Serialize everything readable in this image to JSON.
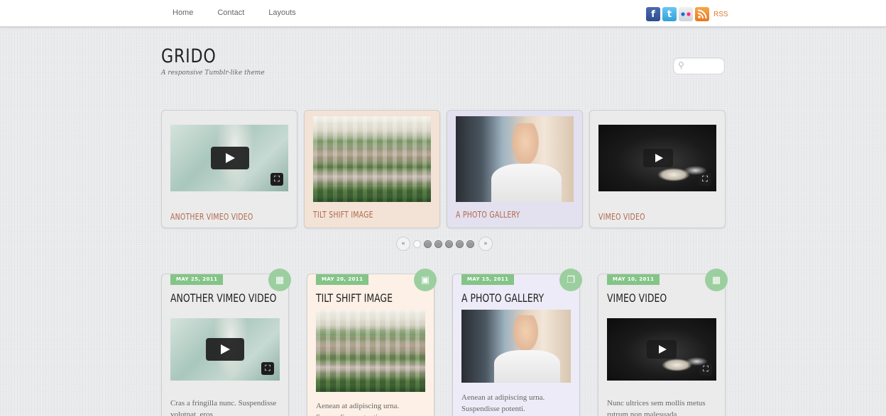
{
  "nav": {
    "items": [
      {
        "label": "Home"
      },
      {
        "label": "Contact"
      },
      {
        "label": "Layouts"
      }
    ]
  },
  "social": {
    "facebook_glyph": "f",
    "twitter_glyph": "t",
    "flickr_glyph": "••",
    "rss_glyph": "◉",
    "rss_label": "RSS"
  },
  "header": {
    "logo": "GRIDO",
    "tagline": "A responsive Tumblr-like theme"
  },
  "search": {
    "icon_glyph": "⚲",
    "placeholder": "",
    "value": ""
  },
  "slider": {
    "prev_label": "«",
    "next_label": "»",
    "slide_count": 6,
    "active_index": 0,
    "items": [
      {
        "title": "ANOTHER VIMEO VIDEO",
        "type": "video",
        "bg": "#ebebeb"
      },
      {
        "title": "TILT SHIFT IMAGE",
        "type": "image",
        "bg": "#f3e3d6"
      },
      {
        "title": "A PHOTO GALLERY",
        "type": "gallery",
        "bg": "#e3e0ef"
      },
      {
        "title": "VIMEO VIDEO",
        "type": "video",
        "bg": "#ebebeb"
      }
    ]
  },
  "posts": [
    {
      "date": "MAY 25, 2011",
      "title": "ANOTHER VIMEO VIDEO",
      "icon": "video-icon",
      "glyph": "▦",
      "excerpt": "Cras a fringilla nunc. Suspendisse volutpat, eros",
      "bg": "#ebebeb"
    },
    {
      "date": "MAY 20, 2011",
      "title": "TILT SHIFT IMAGE",
      "icon": "image-icon",
      "glyph": "▣",
      "excerpt": "Aenean at adipiscing urna. Suspendisse potenti.",
      "bg": "#fdf0e6"
    },
    {
      "date": "MAY 15, 2011",
      "title": "A PHOTO GALLERY",
      "icon": "gallery-icon",
      "glyph": "❐",
      "excerpt": "Aenean at adipiscing urna. Suspendisse potenti.",
      "bg": "#ecebf7"
    },
    {
      "date": "MAY 10, 2011",
      "title": "VIMEO VIDEO",
      "icon": "video-icon",
      "glyph": "▦",
      "excerpt": "Nunc ultrices sem mollis metus rutrum non malesuada",
      "bg": "#ebebeb"
    }
  ],
  "media_icons": {
    "fullscreen_glyph": "⛶"
  },
  "colors": {
    "accent_green": "#84c488",
    "title_rust": "#b0684c"
  }
}
